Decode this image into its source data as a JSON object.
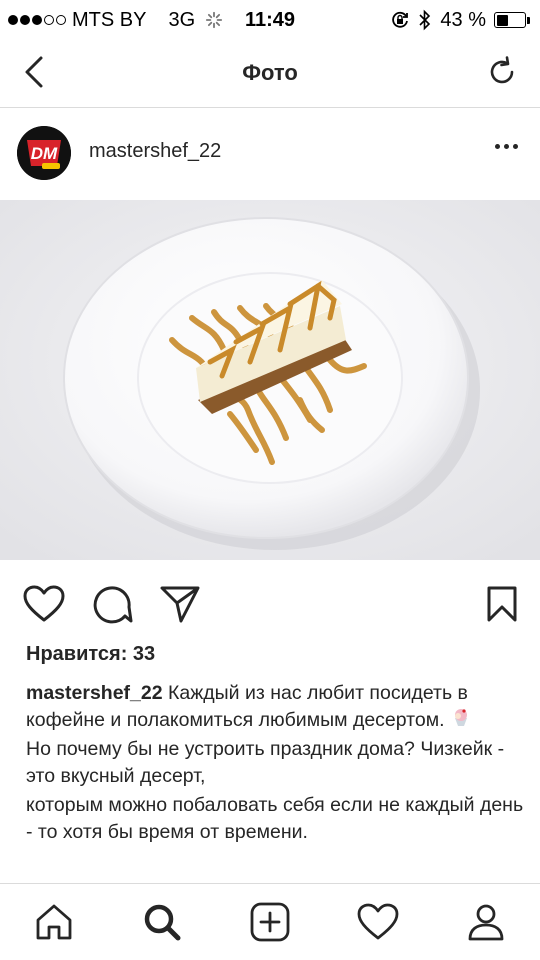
{
  "status_bar": {
    "carrier": "MTS BY",
    "network": "3G",
    "time": "11:49",
    "battery_text": "43 %",
    "battery_level": 0.43
  },
  "nav": {
    "title": "Фото",
    "back_icon": "chevron-left-icon",
    "refresh_icon": "refresh-icon"
  },
  "post": {
    "username": "mastershef_22",
    "avatar_text": "DM",
    "likes_text": "Нравится: 33",
    "caption_author": "mastershef_22",
    "caption_lines": [
      "Каждый из нас любит посидеть в кофейне и полакомиться любимым десертом.",
      "Но почему бы не устроить праздник дома? Чизкейк - это вкусный десерт,",
      "которым можно побаловать себя если не каждый день - то хотя бы время от времени."
    ]
  },
  "actions": {
    "like_icon": "heart-icon",
    "comment_icon": "comment-icon",
    "share_icon": "send-icon",
    "save_icon": "bookmark-icon"
  },
  "tabs": [
    "home-icon",
    "search-icon",
    "add-icon",
    "activity-heart-icon",
    "profile-icon"
  ],
  "colors": {
    "text": "#262626",
    "divider": "#dbdbdb",
    "avatar_red": "#d8232a",
    "caramel": "#c98a2a"
  }
}
